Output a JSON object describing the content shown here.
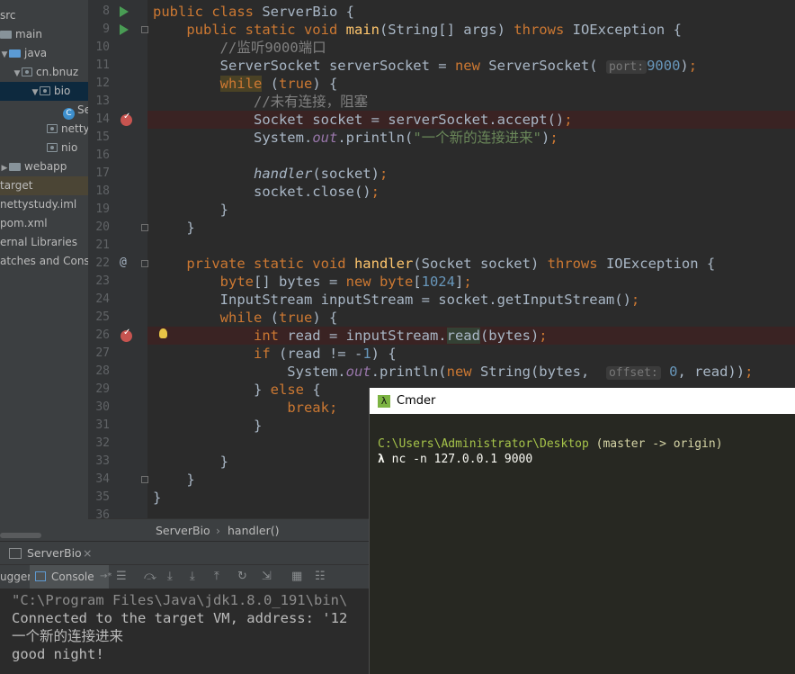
{
  "tree": {
    "items": [
      {
        "label": "src",
        "kind": "folder"
      },
      {
        "label": "main",
        "kind": "folder"
      },
      {
        "label": "java",
        "kind": "folder-blue"
      },
      {
        "label": "cn.bnuz",
        "kind": "package"
      },
      {
        "label": "bio",
        "kind": "package"
      },
      {
        "label": "Se",
        "kind": "class"
      },
      {
        "label": "netty",
        "kind": "package"
      },
      {
        "label": "nio",
        "kind": "package"
      },
      {
        "label": "webapp",
        "kind": "folder"
      },
      {
        "label": "target",
        "kind": "folder"
      },
      {
        "label": "nettystudy.iml",
        "kind": "file"
      },
      {
        "label": "pom.xml",
        "kind": "file"
      },
      {
        "label": "ernal Libraries",
        "kind": "lib"
      },
      {
        "label": "atches and Cons",
        "kind": "lib"
      }
    ]
  },
  "editor": {
    "line_numbers": [
      "8",
      "9",
      "10",
      "11",
      "12",
      "13",
      "14",
      "15",
      "16",
      "17",
      "18",
      "19",
      "20",
      "21",
      "22",
      "23",
      "24",
      "25",
      "26",
      "27",
      "28",
      "29",
      "30",
      "31",
      "32",
      "33",
      "34",
      "35",
      "36"
    ],
    "hints": {
      "port": "port:",
      "offset": "offset:"
    },
    "comments": {
      "listen": "//监听9000端口",
      "no_conn": "//未有连接，阻塞"
    },
    "strings": {
      "new_conn": "\"一个新的连接进来\""
    }
  },
  "breadcrumb": {
    "items": [
      "ServerBio",
      "handler()"
    ]
  },
  "run_bar": {
    "title": "ServerBio"
  },
  "toolbar": {
    "debugger_label": "ugger",
    "console_label": "Console"
  },
  "console": {
    "lines": [
      "\"C:\\Program Files\\Java\\jdk1.8.0_191\\bin\\",
      "Connected to the target VM, address: '12",
      "一个新的连接进来",
      "good night!"
    ]
  },
  "cmder": {
    "title": "Cmder",
    "path": "C:\\Users\\Administrator\\Desktop",
    "branch": "(master -> origin)",
    "prompt": "λ",
    "command": "nc -n 127.0.0.1 9000"
  }
}
